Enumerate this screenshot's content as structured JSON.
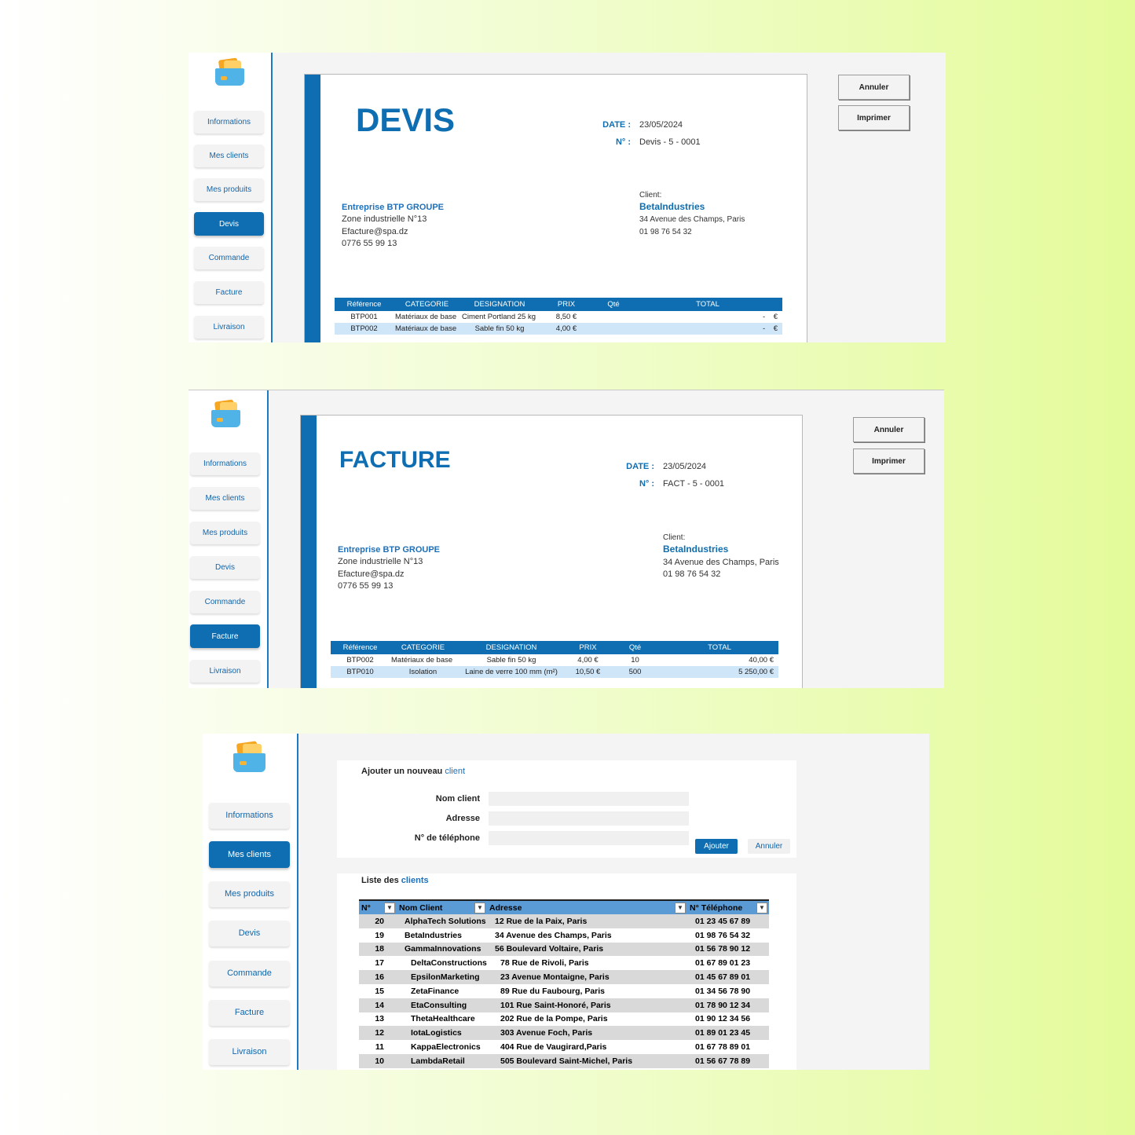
{
  "nav_items": [
    "Informations",
    "Mes clients",
    "Mes produits",
    "Devis",
    "Commande",
    "Facture",
    "Livraison"
  ],
  "actions": {
    "cancel": "Annuler",
    "print": "Imprimer"
  },
  "company": {
    "name": "Entreprise BTP GROUPE",
    "address": "Zone industrielle N°13",
    "email": "Efacture@spa.dz",
    "phone": "0776 55 99 13"
  },
  "client": {
    "label": "Client:",
    "name": "BetaIndustries",
    "address": "34 Avenue des Champs, Paris",
    "phone": "01 98 76 54 32"
  },
  "labels": {
    "date": "DATE :",
    "number": "N° :"
  },
  "table_headers": [
    "Référence",
    "CATEGORIE",
    "DESIGNATION",
    "PRIX",
    "Qté",
    "TOTAL"
  ],
  "devis": {
    "title": "DEVIS",
    "date": "23/05/2024",
    "number": "Devis - 5 - 0001",
    "rows": [
      {
        "ref": "BTP001",
        "cat": "Matériaux de base",
        "des": "Ciment Portland 25 kg",
        "prix": "8,50 €",
        "qte": "",
        "total": "-",
        "cur": "€"
      },
      {
        "ref": "BTP002",
        "cat": "Matériaux de base",
        "des": "Sable fin 50 kg",
        "prix": "4,00 €",
        "qte": "",
        "total": "-",
        "cur": "€"
      }
    ]
  },
  "facture": {
    "title": "FACTURE",
    "date": "23/05/2024",
    "number": "FACT - 5 - 0001",
    "rows": [
      {
        "ref": "BTP002",
        "cat": "Matériaux de base",
        "des": "Sable fin 50 kg",
        "prix": "4,00 €",
        "qte": "10",
        "total": "40,00 €"
      },
      {
        "ref": "BTP010",
        "cat": "Isolation",
        "des": "Laine de verre 100 mm (m²)",
        "prix": "10,50 €",
        "qte": "500",
        "total": "5 250,00 €"
      }
    ]
  },
  "clients_form": {
    "title_prefix": "Ajouter un nouveau ",
    "title_accent": "client",
    "name_label": "Nom client",
    "address_label": "Adresse",
    "phone_label": "N° de téléphone",
    "add": "Ajouter",
    "cancel": "Annuler"
  },
  "clients_list": {
    "title_prefix": "Liste des ",
    "title_accent": "clients",
    "headers": [
      "N°",
      "Nom Client",
      "Adresse",
      "N° Téléphone"
    ],
    "rows": [
      [
        "20",
        "AlphaTech Solutions",
        "12 Rue de la Paix, Paris",
        "01 23 45 67 89"
      ],
      [
        "19",
        "BetaIndustries",
        "34 Avenue des Champs, Paris",
        "01 98 76 54 32"
      ],
      [
        "18",
        "GammaInnovations",
        "56 Boulevard Voltaire, Paris",
        "01 56 78 90 12"
      ],
      [
        "17",
        "DeltaConstructions",
        "78 Rue de Rivoli, Paris",
        "01 67 89 01 23"
      ],
      [
        "16",
        "EpsilonMarketing",
        "23 Avenue Montaigne, Paris",
        "01 45 67 89 01"
      ],
      [
        "15",
        "ZetaFinance",
        "89 Rue du Faubourg, Paris",
        "01 34 56 78 90"
      ],
      [
        "14",
        "EtaConsulting",
        "101 Rue Saint-Honoré, Paris",
        "01 78 90 12 34"
      ],
      [
        "13",
        "ThetaHealthcare",
        "202 Rue de la Pompe, Paris",
        "01 90 12 34 56"
      ],
      [
        "12",
        "IotaLogistics",
        "303 Avenue Foch, Paris",
        "01 89 01 23 45"
      ],
      [
        "11",
        "KappaElectronics",
        "404 Rue de Vaugirard,Paris",
        "01 67 78 89 01"
      ],
      [
        "10",
        "LambdaRetail",
        "505 Boulevard Saint-Michel, Paris",
        "01 56 67 78 89"
      ]
    ]
  }
}
